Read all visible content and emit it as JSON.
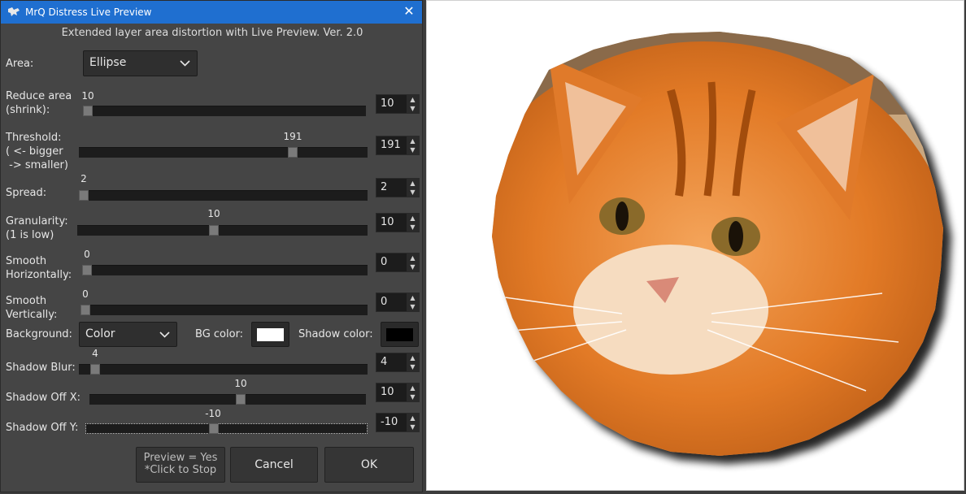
{
  "window": {
    "title": "MrQ Distress Live Preview",
    "subtitle": "Extended layer area distortion with Live Preview. Ver. 2.0"
  },
  "area": {
    "label": "Area:",
    "value": "Ellipse"
  },
  "reduce": {
    "label": "Reduce area\n(shrink):",
    "value": "10",
    "spin": "10",
    "fraction": 0.0
  },
  "threshold": {
    "label": "Threshold:\n( <- bigger\n -> smaller)",
    "value": "191",
    "spin": "191",
    "fraction": 0.749
  },
  "spread": {
    "label": "Spread:",
    "value": "2",
    "spin": "2",
    "fraction": 0.0
  },
  "granularity": {
    "label": "Granularity:\n(1 is low)",
    "value": "10",
    "spin": "10",
    "fraction": 0.47
  },
  "smooth_h": {
    "label": "Smooth\nHorizontally:",
    "value": "0",
    "spin": "0",
    "fraction": 0.0
  },
  "smooth_v": {
    "label": "Smooth\nVertically:",
    "value": "0",
    "spin": "0",
    "fraction": 0.0
  },
  "background": {
    "label": "Background:",
    "value": "Color",
    "bg_label": "BG color:",
    "shadow_label": "Shadow color:",
    "bg_color": "#ffffff",
    "shadow_color": "#000000"
  },
  "shadow_blur": {
    "label": "Shadow Blur:",
    "value": "4",
    "spin": "4",
    "fraction": 0.04
  },
  "shadow_x": {
    "label": "Shadow Off X:",
    "value": "10",
    "spin": "10",
    "fraction": 0.55
  },
  "shadow_y": {
    "label": "Shadow Off Y:",
    "value": "-10",
    "spin": "-10",
    "fraction": 0.45
  },
  "buttons": {
    "preview_line1": "Preview = Yes",
    "preview_line2": "*Click to Stop",
    "cancel": "Cancel",
    "ok": "OK"
  },
  "colors": {
    "titlebar": "#1f6fd0",
    "dialog_bg": "#454545",
    "track": "#1c1c1c"
  },
  "icons": {
    "close": "close-icon",
    "app": "gimp-icon",
    "dropdown": "chevron-down-icon"
  }
}
